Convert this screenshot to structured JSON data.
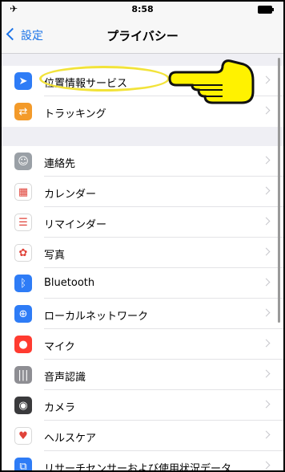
{
  "status_bar": {
    "airplane": "✈",
    "time": "8:58"
  },
  "nav": {
    "back_label": "設定",
    "title": "プライバシー"
  },
  "group1": [
    {
      "label": "位置情報サービス",
      "icon": "location-arrow-icon",
      "color": "#2e7cf6",
      "glyph": "➤"
    },
    {
      "label": "トラッキング",
      "icon": "tracking-icon",
      "color": "#f39a2a",
      "glyph": "⇄"
    }
  ],
  "group2": [
    {
      "label": "連絡先",
      "icon": "contacts-icon",
      "color": "#9aa0a6",
      "glyph": "☺"
    },
    {
      "label": "カレンダー",
      "icon": "calendar-icon",
      "color": "#ffffff",
      "glyph": "▦"
    },
    {
      "label": "リマインダー",
      "icon": "reminders-icon",
      "color": "#ffffff",
      "glyph": "☰"
    },
    {
      "label": "写真",
      "icon": "photos-icon",
      "color": "#ffffff",
      "glyph": "✿"
    },
    {
      "label": "Bluetooth",
      "icon": "bluetooth-icon",
      "color": "#2e7cf6",
      "glyph": "ᛒ"
    },
    {
      "label": "ローカルネットワーク",
      "icon": "globe-icon",
      "color": "#2e7cf6",
      "glyph": "⊕"
    },
    {
      "label": "マイク",
      "icon": "microphone-icon",
      "color": "#ff3b30",
      "glyph": "●"
    },
    {
      "label": "音声認識",
      "icon": "waveform-icon",
      "color": "#8e8e93",
      "glyph": "|||"
    },
    {
      "label": "カメラ",
      "icon": "camera-icon",
      "color": "#3a3a3c",
      "glyph": "◉"
    },
    {
      "label": "ヘルスケア",
      "icon": "heart-icon",
      "color": "#ffffff",
      "glyph": "♥"
    },
    {
      "label": "リサーチセンサーおよび使用状況データ",
      "icon": "research-icon",
      "color": "#2e7cf6",
      "glyph": "⧉"
    }
  ],
  "annotation": {
    "colors": {
      "ellipse": "#f2e33a",
      "hand": "#fff200"
    }
  }
}
